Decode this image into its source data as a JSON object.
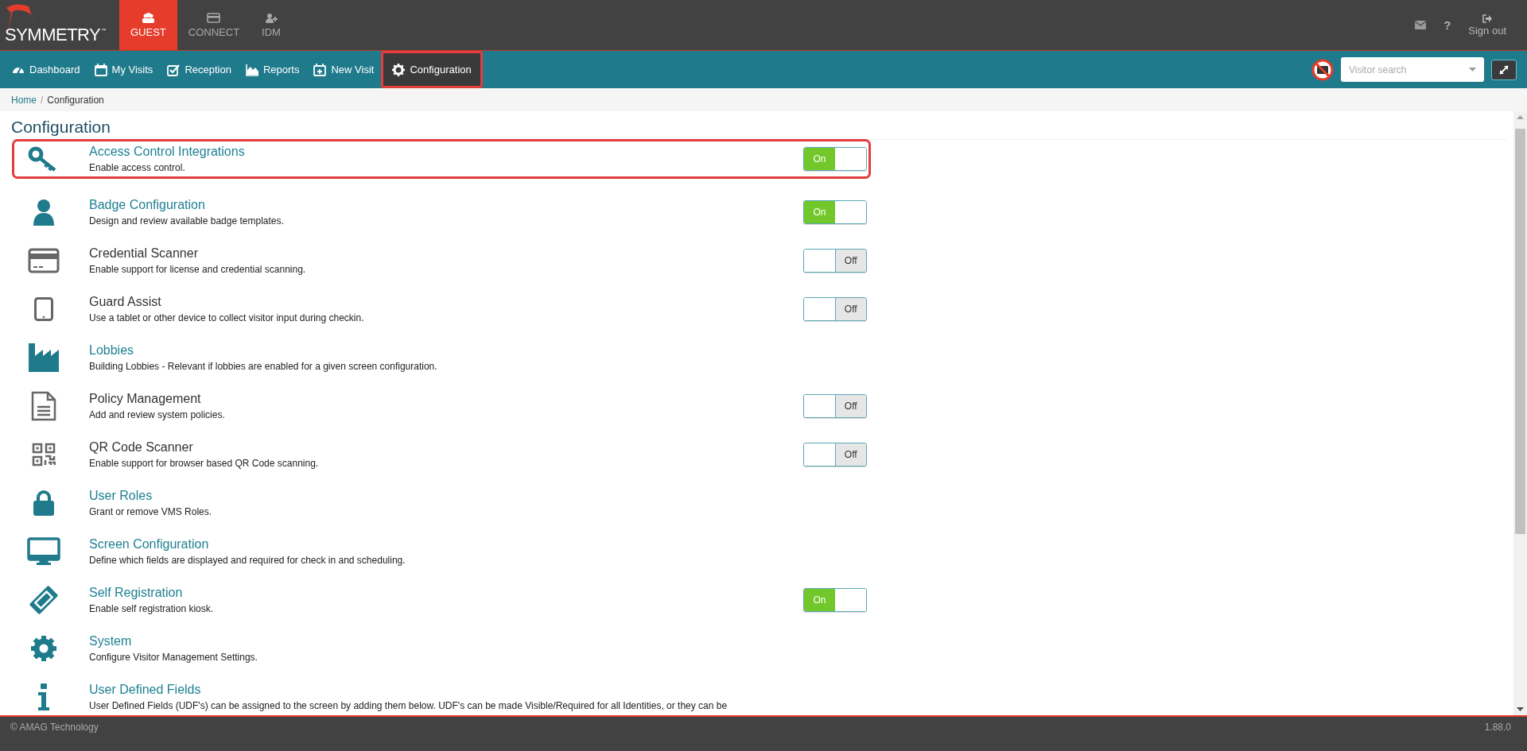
{
  "app": {
    "logo": "SYMMETRY",
    "logo_mark": "™"
  },
  "product_tabs": [
    {
      "label": "GUEST",
      "selected": true
    },
    {
      "label": "CONNECT",
      "selected": false
    },
    {
      "label": "IDM",
      "selected": false
    }
  ],
  "top_actions": {
    "help": "?",
    "sign_out": "Sign out"
  },
  "nav": [
    {
      "label": "Dashboard",
      "selected": false,
      "highlighted": false
    },
    {
      "label": "My Visits",
      "selected": false,
      "highlighted": false
    },
    {
      "label": "Reception",
      "selected": false,
      "highlighted": false
    },
    {
      "label": "Reports",
      "selected": false,
      "highlighted": false
    },
    {
      "label": "New Visit",
      "selected": false,
      "highlighted": false
    },
    {
      "label": "Configuration",
      "selected": true,
      "highlighted": true
    }
  ],
  "visitor_search": {
    "placeholder": "Visitor search"
  },
  "breadcrumb": [
    "Home",
    "Configuration"
  ],
  "breadcrumb_separator": "/",
  "page_title": "Configuration",
  "items": [
    {
      "title": "Access Control Integrations",
      "description": "Enable access control.",
      "linked": true,
      "highlighted": true,
      "toggle": {
        "label": "On",
        "on": true
      }
    },
    {
      "title": "Badge Configuration",
      "description": "Design and review available badge templates.",
      "linked": true,
      "highlighted": false,
      "toggle": {
        "label": "On",
        "on": true
      }
    },
    {
      "title": "Credential Scanner",
      "description": "Enable support for license and credential scanning.",
      "linked": false,
      "highlighted": false,
      "toggle": {
        "label": "Off",
        "on": false
      }
    },
    {
      "title": "Guard Assist",
      "description": "Use a tablet or other device to collect visitor input during checkin.",
      "linked": false,
      "highlighted": false,
      "toggle": {
        "label": "Off",
        "on": false
      }
    },
    {
      "title": "Lobbies",
      "description": "Building Lobbies - Relevant if lobbies are enabled for a given screen configuration.",
      "linked": true,
      "highlighted": false
    },
    {
      "title": "Policy Management",
      "description": "Add and review system policies.",
      "linked": false,
      "highlighted": false,
      "toggle": {
        "label": "Off",
        "on": false
      }
    },
    {
      "title": "QR Code Scanner",
      "description": "Enable support for browser based QR Code scanning.",
      "linked": false,
      "highlighted": false,
      "toggle": {
        "label": "Off",
        "on": false
      }
    },
    {
      "title": "User Roles",
      "description": "Grant or remove VMS Roles.",
      "linked": true,
      "highlighted": false
    },
    {
      "title": "Screen Configuration",
      "description": "Define which fields are displayed and required for check in and scheduling.",
      "linked": true,
      "highlighted": false
    },
    {
      "title": "Self Registration",
      "description": "Enable self registration kiosk.",
      "linked": true,
      "highlighted": false,
      "toggle": {
        "label": "On",
        "on": true
      }
    },
    {
      "title": "System",
      "description": "Configure Visitor Management Settings.",
      "linked": true,
      "highlighted": false
    },
    {
      "title": "User Defined Fields",
      "description": "User Defined Fields (UDF's) can be assigned to the screen by adding them below. UDF's can be made Visible/Required for all Identities, or they can be",
      "linked": true,
      "highlighted": false
    }
  ],
  "footer": {
    "copyright": "© AMAG Technology",
    "version": "1.88.0"
  }
}
